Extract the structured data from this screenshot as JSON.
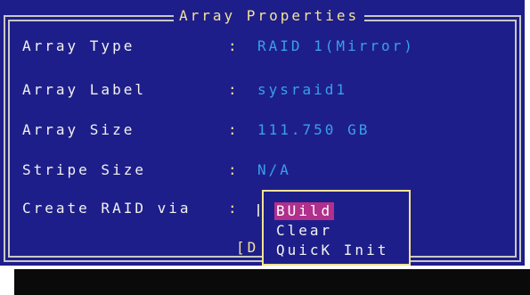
{
  "dialog": {
    "title": "Array Properties"
  },
  "fields": [
    {
      "label": "Array Type",
      "separator": ":",
      "value": "RAID 1(Mirror)"
    },
    {
      "label": "Array Label",
      "separator": ":",
      "value": "sysraid1"
    },
    {
      "label": "Array Size",
      "separator": ":",
      "value": "111.750 GB"
    },
    {
      "label": "Stripe Size",
      "separator": ":",
      "value": "N/A"
    },
    {
      "label": "Create RAID via",
      "separator": ":",
      "value": ""
    }
  ],
  "button_partial": "[D",
  "popup_menu": {
    "items": [
      "BUild",
      "Clear",
      "QuicK Init"
    ],
    "selected_index": 0
  },
  "colors": {
    "background": "#1e1e8a",
    "frame": "#c8c8c8",
    "title_text": "#f2e394",
    "label_text": "#f2f2f2",
    "value_text": "#3aa0e8",
    "selection": "#b0308c",
    "shadow": "#0a0a0a"
  }
}
